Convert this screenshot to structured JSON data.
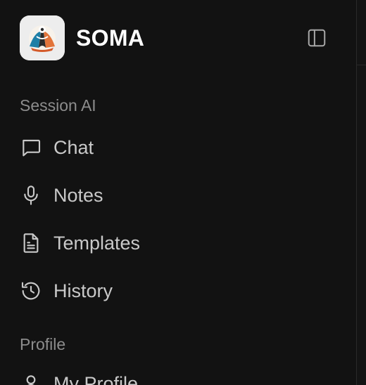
{
  "app": {
    "name": "SOMA"
  },
  "sidebar": {
    "sections": [
      {
        "label": "Session AI",
        "items": [
          {
            "label": "Chat",
            "icon": "chat-bubble-icon"
          },
          {
            "label": "Notes",
            "icon": "microphone-icon"
          },
          {
            "label": "Templates",
            "icon": "document-icon"
          },
          {
            "label": "History",
            "icon": "history-icon"
          }
        ]
      },
      {
        "label": "Profile",
        "items": [
          {
            "label": "My Profile",
            "icon": "user-icon"
          }
        ]
      }
    ]
  },
  "colors": {
    "background": "#121212",
    "text_primary": "#ffffff",
    "text_nav": "#c9c9c9",
    "text_section": "#8c8c8c"
  }
}
